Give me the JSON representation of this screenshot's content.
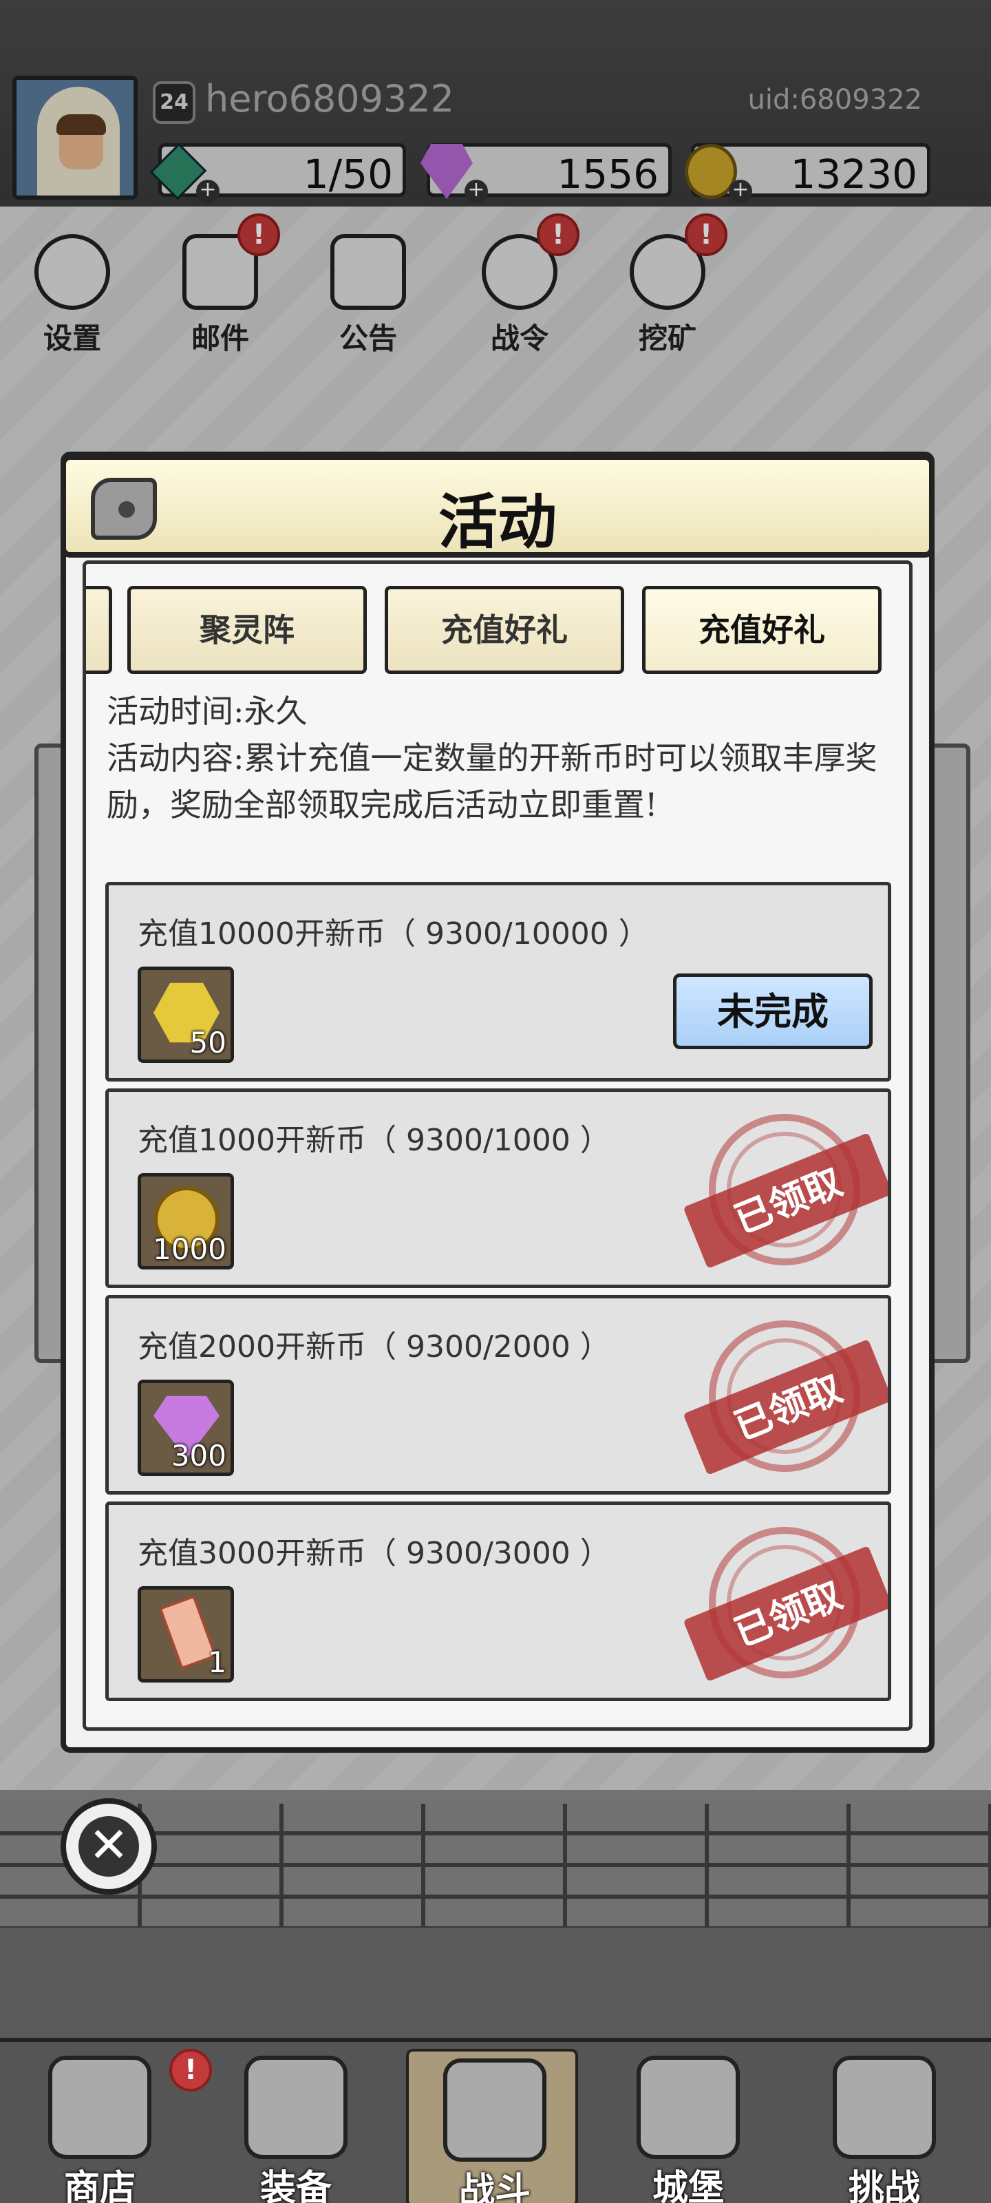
{
  "player": {
    "name": "hero6809322",
    "level": "24",
    "uid": "uid:6809322"
  },
  "resources": {
    "energy": "1/50",
    "gems": "1556",
    "coins": "13230"
  },
  "top_menu": [
    {
      "label": "设置",
      "icon": "gear-icon",
      "badge": ""
    },
    {
      "label": "邮件",
      "icon": "mail-icon",
      "badge": "!"
    },
    {
      "label": "公告",
      "icon": "scroll-icon",
      "badge": ""
    },
    {
      "label": "战令",
      "icon": "battle-pass-icon",
      "badge": "!"
    },
    {
      "label": "挖矿",
      "icon": "mining-icon",
      "badge": "!"
    }
  ],
  "modal": {
    "title": "活动",
    "tabs": [
      "聚灵阵",
      "充值好礼",
      "充值好礼"
    ],
    "active_tab": 2,
    "time_line": "活动时间:永久",
    "content_line": "活动内容:累计充值一定数量的开新币时可以领取丰厚奖励，奖励全部领取完成后活动立即重置!",
    "rewards": [
      {
        "title": "充值10000开新币（ 9300/10000 ）",
        "item": "gold-crystal-icon",
        "qty": "50",
        "status": "未完成",
        "claimed": false
      },
      {
        "title": "充值1000开新币（ 9300/1000 ）",
        "item": "gold-coin-icon",
        "qty": "1000",
        "status": "已领取",
        "claimed": true
      },
      {
        "title": "充值2000开新币（ 9300/2000 ）",
        "item": "purple-gem-icon",
        "qty": "300",
        "status": "已领取",
        "claimed": true
      },
      {
        "title": "充值3000开新币（ 9300/3000 ）",
        "item": "ticket-icon",
        "qty": "1",
        "status": "已领取",
        "claimed": true
      }
    ]
  },
  "bottom_nav": [
    {
      "label": "商店",
      "icon": "shop-icon",
      "badge": "!"
    },
    {
      "label": "装备",
      "icon": "backpack-icon",
      "badge": ""
    },
    {
      "label": "战斗",
      "icon": "crossed-swords-icon",
      "badge": ""
    },
    {
      "label": "城堡",
      "icon": "castle-icon",
      "badge": ""
    },
    {
      "label": "挑战",
      "icon": "shield-icon",
      "badge": ""
    }
  ],
  "colors": {
    "badge_red": "#c23a3a",
    "incomplete_button": "#a9d0f7",
    "claimed_stamp": "#b23232",
    "title_bar": "#fffbe0"
  }
}
